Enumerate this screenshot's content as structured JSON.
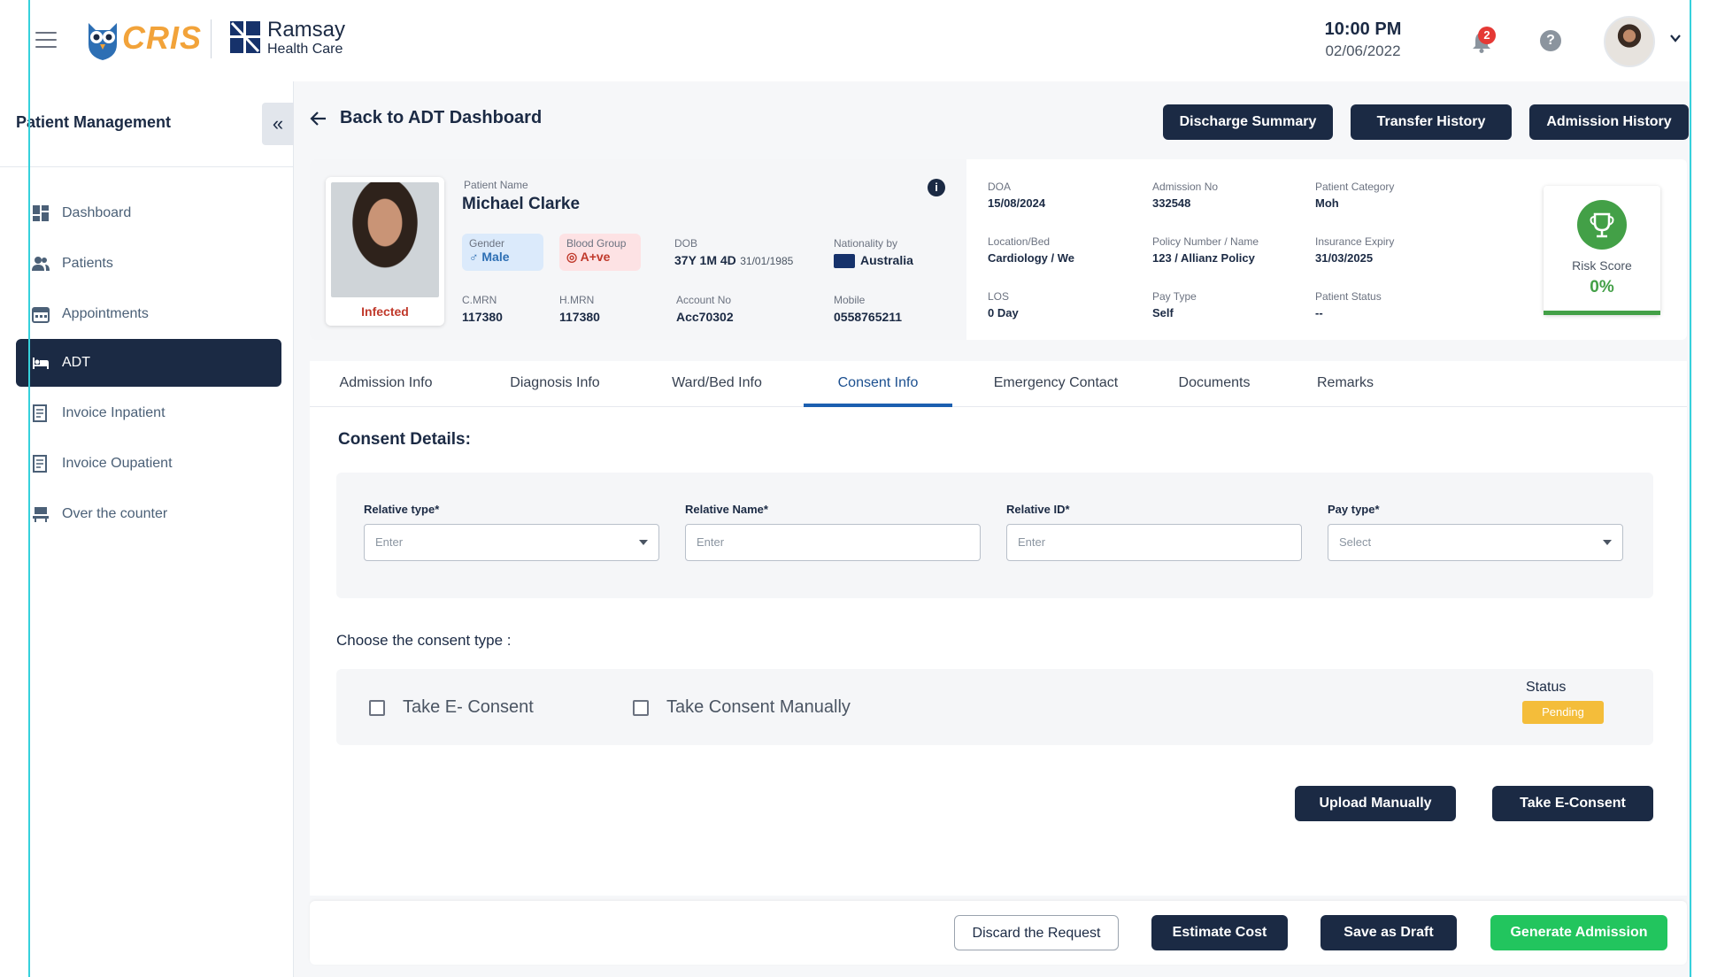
{
  "header": {
    "logo_text": "CRIS",
    "hospital_name": "Ramsay",
    "hospital_sub": "Health Care",
    "time": "10:00 PM",
    "date": "02/06/2022",
    "notification_count": "2",
    "help_glyph": "?"
  },
  "sidebar": {
    "title": "Patient Management",
    "collapse_glyph": "«",
    "items": [
      {
        "label": "Dashboard",
        "icon": "dashboard-icon"
      },
      {
        "label": "Patients",
        "icon": "patients-icon"
      },
      {
        "label": "Appointments",
        "icon": "calendar-icon"
      },
      {
        "label": "ADT",
        "icon": "bed-icon",
        "active": true
      },
      {
        "label": "Invoice Inpatient",
        "icon": "invoice-icon"
      },
      {
        "label": "Invoice Oupatient",
        "icon": "invoice-icon"
      },
      {
        "label": "Over the counter",
        "icon": "counter-icon"
      }
    ]
  },
  "page": {
    "back_label": "Back to ADT Dashboard",
    "top_buttons": {
      "discharge": "Discharge Summary",
      "transfer": "Transfer History",
      "admission": "Admission History"
    }
  },
  "patient": {
    "status_tag": "Infected",
    "name_label": "Patient Name",
    "name": "Michael Clarke",
    "gender_label": "Gender",
    "gender": "♂ Male",
    "blood_label": "Blood Group",
    "blood": "A+ve",
    "dob_label": "DOB",
    "dob_age": "37Y 1M 4D",
    "dob_date": "31/01/1985",
    "nationality_label": "Nationality by",
    "nationality": "Australia",
    "cmrn_label": "C.MRN",
    "cmrn": "117380",
    "hmrn_label": "H.MRN",
    "hmrn": "117380",
    "account_label": "Account No",
    "account": "Acc70302",
    "mobile_label": "Mobile",
    "mobile": "0558765211",
    "doa_label": "DOA",
    "doa": "15/08/2024",
    "admission_no_label": "Admission No",
    "admission_no": "332548",
    "category_label": "Patient Category",
    "category": "Moh",
    "location_label": "Location/Bed",
    "location": "Cardiology / We",
    "policy_label": "Policy Number / Name",
    "policy": "123 / Allianz Policy",
    "insurance_label": "Insurance Expiry",
    "insurance": "31/03/2025",
    "los_label": "LOS",
    "los": "0 Day",
    "paytype_label": "Pay Type",
    "paytype": "Self",
    "pstatus_label": "Patient Status",
    "pstatus": "--",
    "risk_label": "Risk Score",
    "risk_value": "0%"
  },
  "tabs": [
    "Admission  Info",
    "Diagnosis Info",
    "Ward/Bed Info",
    "Consent Info",
    "Emergency Contact",
    "Documents",
    "Remarks"
  ],
  "consent": {
    "title": "Consent Details:",
    "fields": {
      "relative_type_label": "Relative type*",
      "relative_type_placeholder": "Enter",
      "relative_name_label": "Relative Name*",
      "relative_name_placeholder": "Enter",
      "relative_id_label": "Relative ID*",
      "relative_id_placeholder": "Enter",
      "pay_type_label": "Pay type*",
      "pay_type_placeholder": "Select"
    },
    "choose_label": "Choose the consent type :",
    "option_e": "Take E- Consent",
    "option_manual": "Take Consent Manually",
    "status_label": "Status",
    "status_value": "Pending",
    "upload_button": "Upload Manually",
    "econsent_button": "Take E-Consent"
  },
  "footer": {
    "discard": "Discard the Request",
    "estimate": "Estimate Cost",
    "draft": "Save as Draft",
    "generate": "Generate Admission"
  },
  "colors": {
    "primary": "#1b2a44",
    "accent_tab": "#1b5fb0",
    "success": "#22c55e",
    "pending": "#f4bd3a",
    "danger": "#c0392b"
  }
}
